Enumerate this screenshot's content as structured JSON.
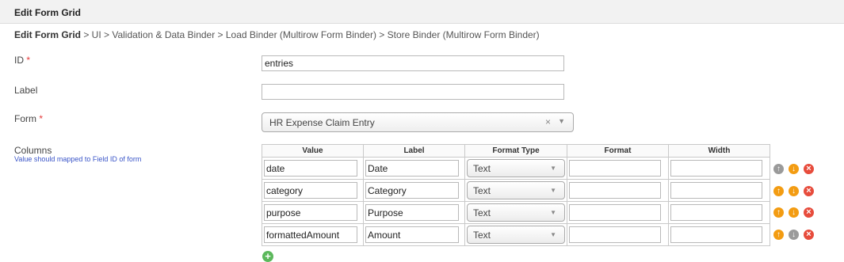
{
  "header": {
    "title": "Edit Form Grid"
  },
  "breadcrumb": {
    "current": "Edit Form Grid",
    "path": " > UI > Validation & Data Binder > Load Binder (Multirow Form Binder) > Store Binder (Multirow Form Binder)"
  },
  "fields": {
    "id": {
      "label": "ID",
      "required_mark": "*",
      "value": "entries"
    },
    "label": {
      "label": "Label",
      "value": ""
    },
    "form": {
      "label": "Form",
      "required_mark": "*",
      "value": "HR Expense Claim Entry",
      "clear": "×",
      "arrow": "▼"
    },
    "columns": {
      "label": "Columns",
      "hint": "Value should mapped to Field ID of form"
    }
  },
  "grid": {
    "headers": [
      "Value",
      "Label",
      "Format Type",
      "Format",
      "Width"
    ],
    "rows": [
      {
        "value": "date",
        "label": "Date",
        "format_type": "Text",
        "format": "",
        "width": ""
      },
      {
        "value": "category",
        "label": "Category",
        "format_type": "Text",
        "format": "",
        "width": ""
      },
      {
        "value": "purpose",
        "label": "Purpose",
        "format_type": "Text",
        "format": "",
        "width": ""
      },
      {
        "value": "formattedAmount",
        "label": "Amount",
        "format_type": "Text",
        "format": "",
        "width": ""
      }
    ]
  },
  "icons": {
    "up": "arrow-up-icon",
    "down": "arrow-down-icon",
    "delete": "delete-icon",
    "add": "add-icon",
    "dropdown": "▼"
  },
  "colors": {
    "accent_orange": "#f39c12",
    "delete_red": "#e74c3c",
    "add_green": "#5cb85c",
    "required_red": "#e53a3a",
    "hint_blue": "#3a55c8"
  }
}
